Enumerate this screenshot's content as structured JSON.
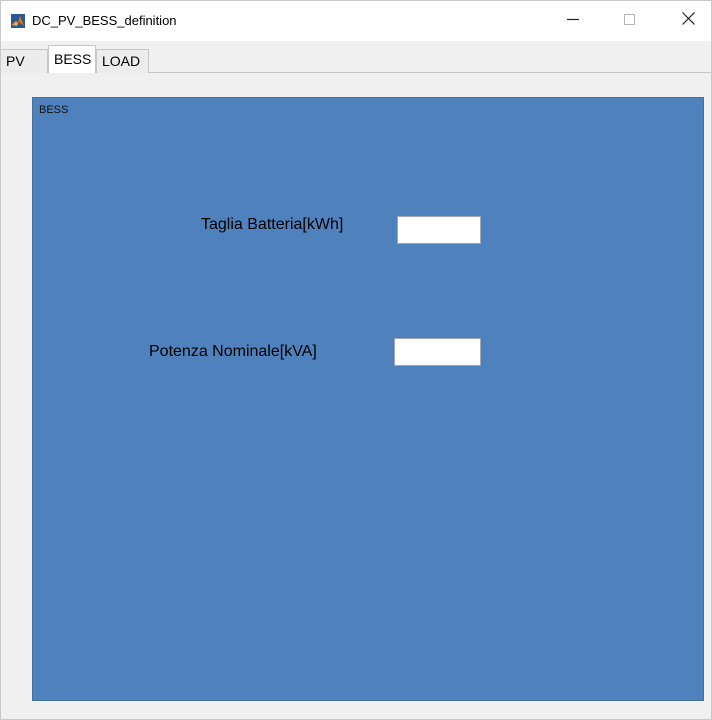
{
  "window": {
    "title": "DC_PV_BESS_definition",
    "icon": "matlab-icon",
    "controls": {
      "minimize": "minimize-icon",
      "maximize": "maximize-icon",
      "close": "close-icon"
    }
  },
  "tabs": [
    {
      "label": "PV",
      "selected": false
    },
    {
      "label": "BESS",
      "selected": true
    },
    {
      "label": "LOAD",
      "selected": false
    }
  ],
  "panel": {
    "title": "BESS",
    "background": "#4f81bd",
    "fields": [
      {
        "label": "Taglia Batteria[kWh]",
        "value": ""
      },
      {
        "label": "Potenza Nominale[kVA]",
        "value": ""
      }
    ]
  }
}
